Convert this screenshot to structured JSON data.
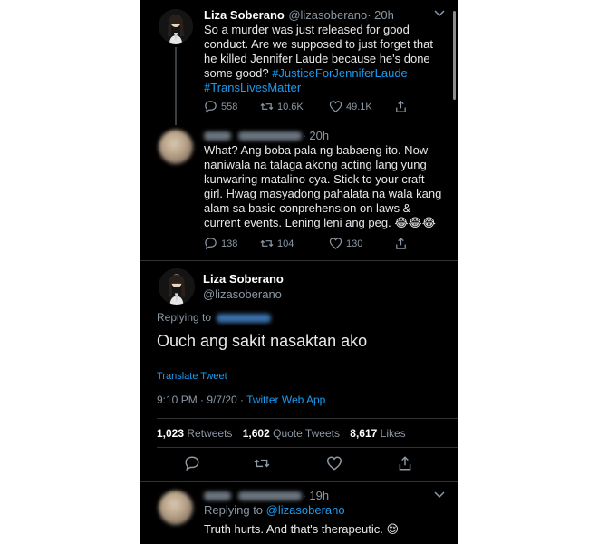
{
  "tweet1": {
    "name": "Liza Soberano",
    "handle": "@lizasoberano",
    "time": "· 20h",
    "text_lines": [
      "So a murder was just released for good",
      "conduct. Are we supposed to just forget that",
      "he killed Jennifer Laude because he's done",
      "some good?"
    ],
    "hashtag1": "#JusticeForJenniferLaude",
    "hashtag2": "#TransLivesMatter",
    "replies": "558",
    "retweets": "10.6K",
    "likes": "49.1K"
  },
  "reply1": {
    "time": "· 20h",
    "text_lines": [
      "What? Ang boba pala ng babaeng ito. Now",
      "naniwala na talaga akong acting lang yung",
      "kunwaring matalino cya. Stick to your craft",
      "girl. Hwag masyadong pahalata na wala kang",
      "alam sa basic conprehension on laws &",
      "current events. Lening leni ang peg."
    ],
    "emoji": "😂😂😂",
    "replies": "138",
    "retweets": "104",
    "likes": "130"
  },
  "main": {
    "name": "Liza Soberano",
    "handle": "@lizasoberano",
    "replying_to": "Replying to",
    "text": "Ouch ang sakit nasaktan ako",
    "translate": "Translate Tweet",
    "timestamp": "9:10 PM · 9/7/20 · ",
    "source": "Twitter Web App",
    "retweets_num": "1,023",
    "retweets_lbl": "Retweets",
    "quotes_num": "1,602",
    "quotes_lbl": "Quote Tweets",
    "likes_num": "8,617",
    "likes_lbl": "Likes"
  },
  "reply2": {
    "time": "· 19h",
    "replying_to": "Replying to",
    "mention": "@lizasoberano",
    "text": "Truth hurts. And that's therapeutic.",
    "emoji": "😌"
  },
  "colors": {
    "background": "#000000",
    "link": "#1d9bf0",
    "secondary": "#8b98a5"
  }
}
